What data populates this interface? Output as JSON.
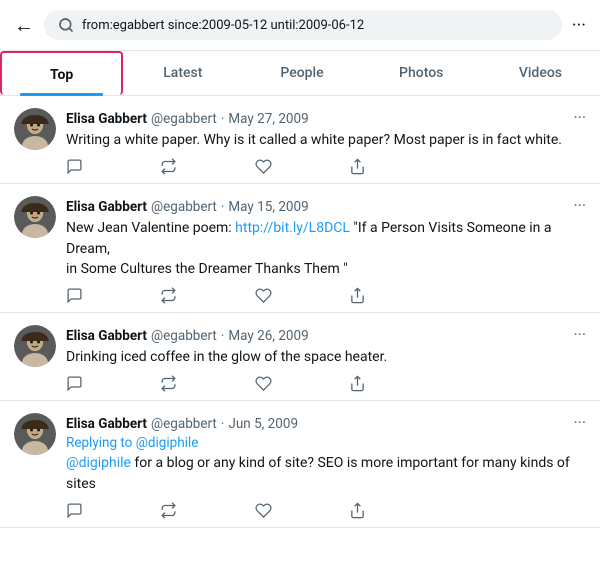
{
  "header": {
    "back_label": "←",
    "search_query": "from:egabbert since:2009-05-12 until:2009-06-12",
    "more_label": "···"
  },
  "tabs": [
    {
      "id": "top",
      "label": "Top",
      "active": true
    },
    {
      "id": "latest",
      "label": "Latest",
      "active": false
    },
    {
      "id": "people",
      "label": "People",
      "active": false
    },
    {
      "id": "photos",
      "label": "Photos",
      "active": false
    },
    {
      "id": "videos",
      "label": "Videos",
      "active": false
    }
  ],
  "tweets": [
    {
      "id": "tweet-1",
      "name": "Elisa Gabbert",
      "handle": "@egabbert",
      "date": "May 27, 2009",
      "text": "Writing a white paper. Why is it called a white paper? Most paper is in fact white.",
      "replying_to": null,
      "reply_target": null
    },
    {
      "id": "tweet-2",
      "name": "Elisa Gabbert",
      "handle": "@egabbert",
      "date": "May 15, 2009",
      "text": "New Jean Valentine poem: http://bit.ly/L8DCL “If a Person Visits Someone in a Dream,\nin Some Cultures the Dreamer Thanks Them ”",
      "replying_to": null,
      "reply_target": null
    },
    {
      "id": "tweet-3",
      "name": "Elisa Gabbert",
      "handle": "@egabbert",
      "date": "May 26, 2009",
      "text": "Drinking iced coffee in the glow of the space heater.",
      "replying_to": null,
      "reply_target": null
    },
    {
      "id": "tweet-4",
      "name": "Elisa Gabbert",
      "handle": "@egabbert",
      "date": "Jun 5, 2009",
      "text": " for a blog or any kind of site? SEO is more important for many kinds of sites",
      "replying_to": "Replying to",
      "reply_target": "@digiphile",
      "mention": "@digiphile"
    }
  ],
  "actions": {
    "reply": "💬",
    "retweet": "🔁",
    "like": "🤍",
    "share": "⬆"
  }
}
